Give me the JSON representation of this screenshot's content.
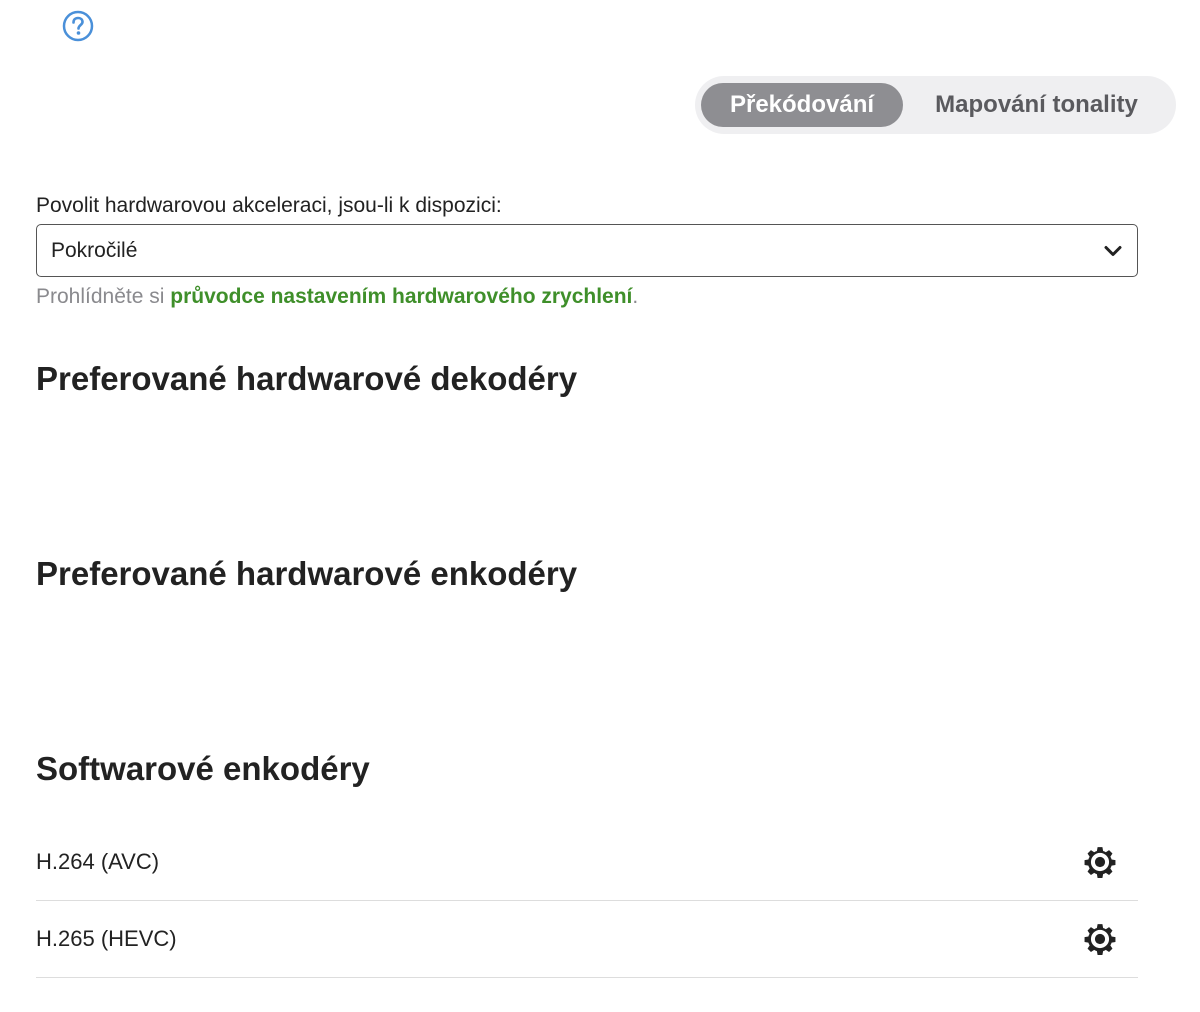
{
  "icons": {
    "help": "question-circle-icon",
    "chevron": "chevron-down-icon",
    "settings": "gear-icon"
  },
  "colors": {
    "help_icon": "#4a90d9",
    "link": "#3f8f2a",
    "tab_active_bg": "#8e8e92",
    "tab_track_bg": "#efeff1"
  },
  "tabs": [
    {
      "label": "Překódování",
      "active": true
    },
    {
      "label": "Mapování tonality",
      "active": false
    }
  ],
  "hw_accel": {
    "label": "Povolit hardwarovou akceleraci, jsou-li k dispozici:",
    "selected": "Pokročilé"
  },
  "hint": {
    "prefix": "Prohlídněte si ",
    "link_text": "průvodce nastavením hardwarového zrychlení",
    "suffix": "."
  },
  "sections": {
    "decoders_title": "Preferované hardwarové dekodéry",
    "encoders_title": "Preferované hardwarové enkodéry",
    "software_title": "Softwarové enkodéry"
  },
  "software_encoders": [
    {
      "label": "H.264 (AVC)"
    },
    {
      "label": "H.265 (HEVC)"
    }
  ]
}
